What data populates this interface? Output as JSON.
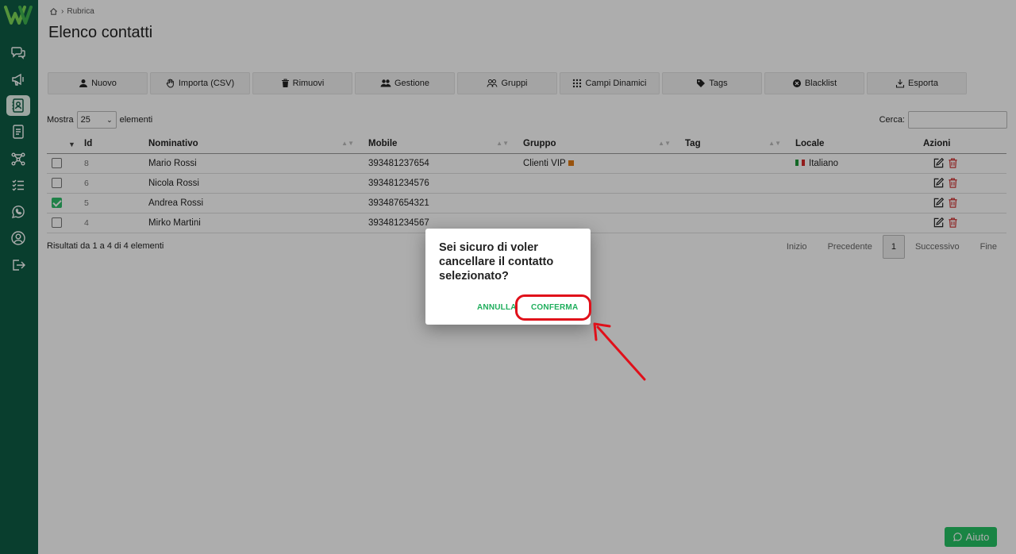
{
  "breadcrumb": {
    "label": "Rubrica"
  },
  "page": {
    "title": "Elenco contatti"
  },
  "toolbar": {
    "buttons": [
      {
        "label": "Nuovo",
        "icon": "user-icon"
      },
      {
        "label": "Importa (CSV)",
        "icon": "hand-icon"
      },
      {
        "label": "Rimuovi",
        "icon": "trash-icon"
      },
      {
        "label": "Gestione",
        "icon": "users-icon"
      },
      {
        "label": "Gruppi",
        "icon": "group-icon"
      },
      {
        "label": "Campi Dinamici",
        "icon": "grid-icon"
      },
      {
        "label": "Tags",
        "icon": "tag-icon"
      },
      {
        "label": "Blacklist",
        "icon": "block-icon"
      },
      {
        "label": "Esporta",
        "icon": "export-icon"
      }
    ]
  },
  "table_controls": {
    "show_prefix": "Mostra",
    "show_value": "25",
    "show_suffix": "elementi",
    "search_label": "Cerca:",
    "search_value": ""
  },
  "table": {
    "headers": [
      "Id",
      "Nominativo",
      "Mobile",
      "Gruppo",
      "Tag",
      "Locale",
      "Azioni"
    ],
    "rows": [
      {
        "checked": false,
        "id": "8",
        "name": "Mario Rossi",
        "mobile": "393481237654",
        "group": "Clienti VIP",
        "tag": "",
        "locale": "Italiano"
      },
      {
        "checked": false,
        "id": "6",
        "name": "Nicola Rossi",
        "mobile": "393481234576",
        "group": "",
        "tag": "",
        "locale": ""
      },
      {
        "checked": true,
        "id": "5",
        "name": "Andrea Rossi",
        "mobile": "393487654321",
        "group": "",
        "tag": "",
        "locale": ""
      },
      {
        "checked": false,
        "id": "4",
        "name": "Mirko Martini",
        "mobile": "393481234567",
        "group": "",
        "tag": "",
        "locale": ""
      }
    ]
  },
  "results": {
    "text": "Risultati da 1 a 4 di 4 elementi"
  },
  "pagination": {
    "first": "Inizio",
    "prev": "Precedente",
    "current": "1",
    "next": "Successivo",
    "last": "Fine"
  },
  "help": {
    "label": "Aiuto"
  },
  "dialog": {
    "message": "Sei sicuro di voler cancellare il contatto selezionato?",
    "cancel_label": "ANNULLA",
    "confirm_label": "CONFERMA"
  },
  "colors": {
    "sidebar": "#0e5c45",
    "accent": "#1fae5c",
    "highlight": "#e0101a",
    "vip_badge": "#e07b16"
  }
}
